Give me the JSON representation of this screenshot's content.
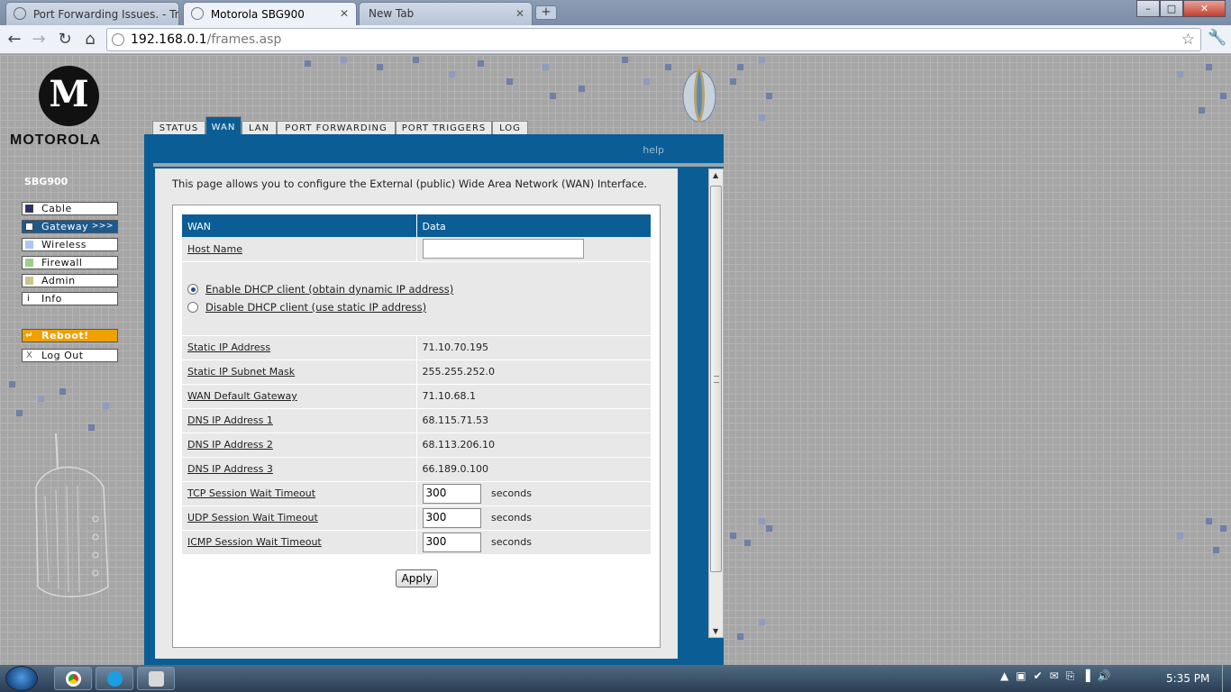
{
  "browser": {
    "tabs": [
      {
        "title": "Port Forwarding Issues. - Tr",
        "active": false
      },
      {
        "title": "Motorola SBG900",
        "active": true
      },
      {
        "title": "New Tab",
        "active": false
      }
    ],
    "new_tab_symbol": "+",
    "window_controls": {
      "minimize": "–",
      "maximize": "□",
      "close": "✕"
    },
    "nav": {
      "back": "←",
      "forward": "→",
      "reload": "↻",
      "home": "⌂"
    },
    "url_host": "192.168.0.1",
    "url_path": "/frames.asp",
    "star": "☆",
    "wrench": "🔧"
  },
  "router": {
    "brand": "MOTOROLA",
    "logo_letter": "M",
    "model": "SBG900",
    "tabs": [
      "STATUS",
      "WAN",
      "LAN",
      "PORT FORWARDING",
      "PORT TRIGGERS",
      "LOG"
    ],
    "active_tab": "WAN",
    "help": "help",
    "menu": [
      {
        "label": "Cable",
        "color": "#2a2f6b"
      },
      {
        "label": "Gateway",
        "color": "#ffffff",
        "selected": true,
        "arrows": ">>>"
      },
      {
        "label": "Wireless",
        "color": "#a9c7f0"
      },
      {
        "label": "Firewall",
        "color": "#9ccf8c"
      },
      {
        "label": "Admin",
        "color": "#c8c48e"
      },
      {
        "label": "Info",
        "color": "",
        "glyph": "i"
      }
    ],
    "reboot": {
      "label": "Reboot!",
      "glyph": "↵"
    },
    "logout": {
      "label": "Log Out",
      "glyph": "X"
    },
    "intro": "This page allows you to configure the External (public) Wide Area Network (WAN) Interface.",
    "table": {
      "headers": [
        "WAN",
        "Data"
      ],
      "host_name_label": "Host Name",
      "host_name_value": "",
      "dhcp_options": [
        {
          "label": "Enable DHCP client (obtain dynamic IP address)",
          "checked": true
        },
        {
          "label": "Disable DHCP client (use static IP address)",
          "checked": false
        }
      ],
      "static_rows": [
        {
          "label": "Static IP Address",
          "value": "71.10.70.195"
        },
        {
          "label": "Static IP Subnet Mask",
          "value": "255.255.252.0"
        },
        {
          "label": "WAN Default Gateway",
          "value": "71.10.68.1"
        },
        {
          "label": "DNS IP Address 1",
          "value": "68.115.71.53"
        },
        {
          "label": "DNS IP Address 2",
          "value": "68.113.206.10"
        },
        {
          "label": "DNS IP Address 3",
          "value": "66.189.0.100"
        }
      ],
      "timeout_rows": [
        {
          "label": "TCP Session Wait Timeout",
          "value": "300",
          "unit": "seconds"
        },
        {
          "label": "UDP Session Wait Timeout",
          "value": "300",
          "unit": "seconds"
        },
        {
          "label": "ICMP Session Wait Timeout",
          "value": "300",
          "unit": "seconds"
        }
      ]
    },
    "apply": "Apply"
  },
  "taskbar": {
    "clock": "5:35 PM",
    "tray_icons": [
      "▲",
      "▣",
      "✔",
      "✉",
      "⎘",
      "▐",
      "🔊"
    ]
  }
}
